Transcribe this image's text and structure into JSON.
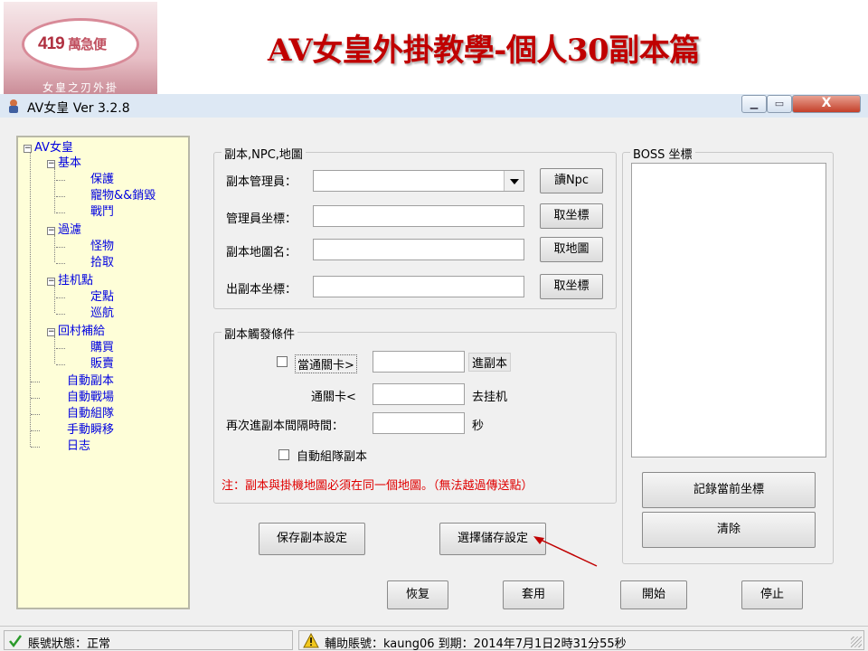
{
  "slide": {
    "title": "AV女皇外掛教學-個人30副本篇",
    "logo_number": "419",
    "logo_text": "萬急便",
    "logo_caption": "女皇之刃外掛"
  },
  "window": {
    "title": "AV女皇    Ver  3.2.8",
    "controls": {
      "minimize": "▁",
      "maximize": "▭",
      "close": "X"
    }
  },
  "tree": {
    "root": "AV女皇",
    "nodes": [
      {
        "label": "基本",
        "children": [
          "保護",
          "寵物&&銷毀",
          "戰鬥"
        ]
      },
      {
        "label": "過濾",
        "children": [
          "怪物",
          "拾取"
        ]
      },
      {
        "label": "挂机點",
        "children": [
          "定點",
          "巡航"
        ]
      },
      {
        "label": "回村補給",
        "children": [
          "購買",
          "販賣"
        ]
      }
    ],
    "leaves": [
      "自動副本",
      "自動戰場",
      "自動組隊",
      "手動瞬移",
      "日志"
    ]
  },
  "dungeon_group": {
    "title": "副本,NPC,地圖",
    "manager_label": "副本管理員：",
    "manager_value": "",
    "read_npc_button": "讀Npc",
    "manager_coord_label": "管理員坐標：",
    "manager_coord_value": "",
    "get_coord_button": "取坐標",
    "map_name_label": "副本地圖名：",
    "map_name_value": "",
    "get_map_button": "取地圖",
    "exit_coord_label": "出副本坐標：",
    "exit_coord_value": "",
    "get_exit_coord_button": "取坐標"
  },
  "trigger_group": {
    "title": "副本觸發條件",
    "when_level_label": "當通關卡>",
    "when_level_value": "",
    "enter_label": "進副本",
    "level_label": "通關卡<",
    "level_value": "",
    "go_afk_label": "去挂机",
    "interval_label": "再次進副本間隔時間：",
    "interval_value": "",
    "seconds_label": "秒",
    "auto_team_label": "自動組隊副本"
  },
  "note": "注：副本與掛機地圖必須在同一個地圖。（無法越過傳送點）",
  "buttons": {
    "save_settings": "保存副本設定",
    "choose_saved": "選擇儲存設定",
    "restore": "恢复",
    "apply": "套用",
    "start": "開始",
    "stop": "停止"
  },
  "boss_group": {
    "title": "BOSS 坐標",
    "record_button": "記錄當前坐標",
    "clear_button": "清除"
  },
  "status": {
    "account_status": "賬號狀態：正常",
    "assist_info": "輔助賬號：kaung06  到期：2014年7月1日2時31分55秒"
  },
  "colors": {
    "note": "#e00000",
    "tree_text": "#0000e0",
    "tree_bg": "#fefed8",
    "slide_title": "#c00000",
    "annotation_arrow": "#c00000"
  }
}
